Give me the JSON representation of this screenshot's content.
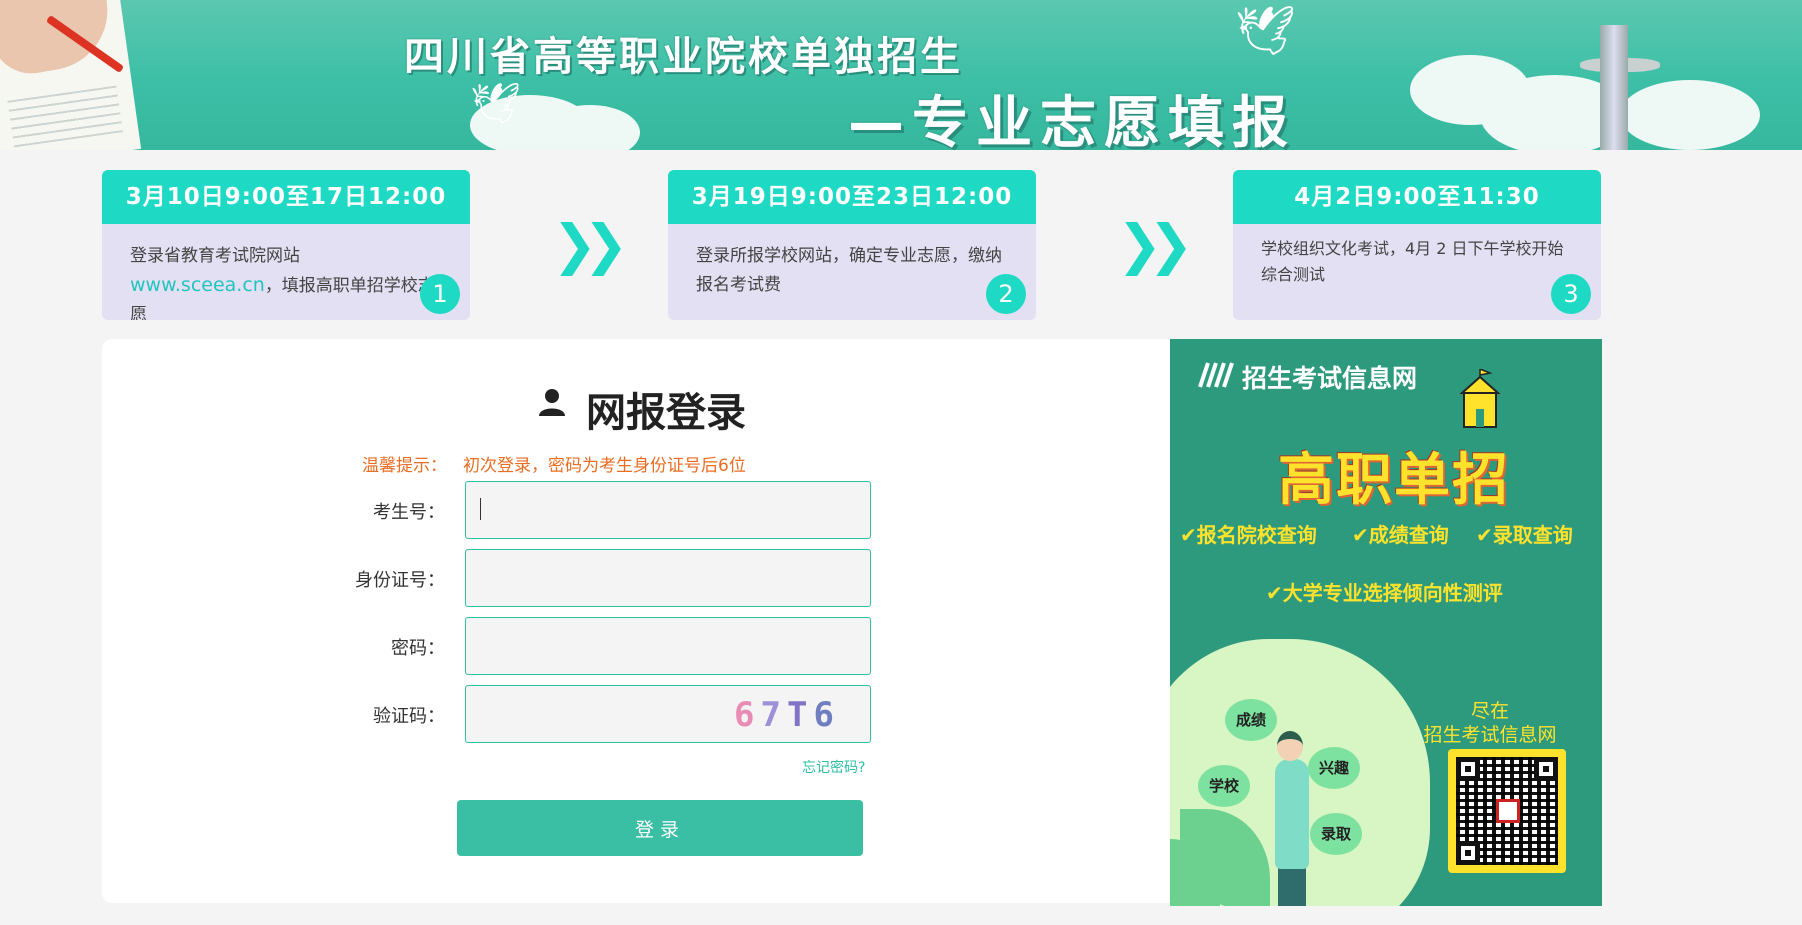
{
  "banner": {
    "line1": "四川省高等职业院校单独招生",
    "line2": "—专业志愿填报"
  },
  "steps": [
    {
      "time": "3月10日9:00至17日12:00",
      "text_before": "登录省教育考试院网站",
      "link": "www.sceea.cn",
      "text_after": "，填报高职单招学校志愿",
      "num": "1"
    },
    {
      "time": "3月19日9:00至23日12:00",
      "text_before": "登录所报学校网站，确定专业志愿，缴纳报名考试费",
      "link": "",
      "text_after": "",
      "num": "2"
    },
    {
      "time": "4月2日9:00至11:30",
      "text_before": "学校组织文化考试，4月 2 日下午学校开始综合测试",
      "link": "",
      "text_after": "",
      "num": "3"
    }
  ],
  "login": {
    "title": "网报登录",
    "hint_label": "温馨提示：",
    "hint_text": "初次登录，密码为考生身份证号后6位",
    "fields": [
      {
        "label": "考生号：",
        "value": ""
      },
      {
        "label": "身份证号：",
        "value": ""
      },
      {
        "label": "密码：",
        "value": ""
      },
      {
        "label": "验证码：",
        "value": ""
      }
    ],
    "captcha": [
      "6",
      "7",
      "T",
      "6"
    ],
    "forgot": "忘记密码?",
    "submit": "登录"
  },
  "ad": {
    "site": "招生考试信息网",
    "big_title": "高职单招",
    "features": [
      "✔报名院校查询",
      "✔成绩查询",
      "✔录取查询",
      "✔大学专业选择倾向性测评"
    ],
    "bubbles": [
      "成绩",
      "兴趣",
      "学校",
      "录取"
    ],
    "cta_line1": "尽在",
    "cta_line2": "招生考试信息网"
  },
  "colors": {
    "accent": "#1ed9c3",
    "button": "#3abea4",
    "hint": "#e96d22",
    "ad_bg": "#2d9a7e",
    "ad_yellow": "#ffe22b"
  }
}
